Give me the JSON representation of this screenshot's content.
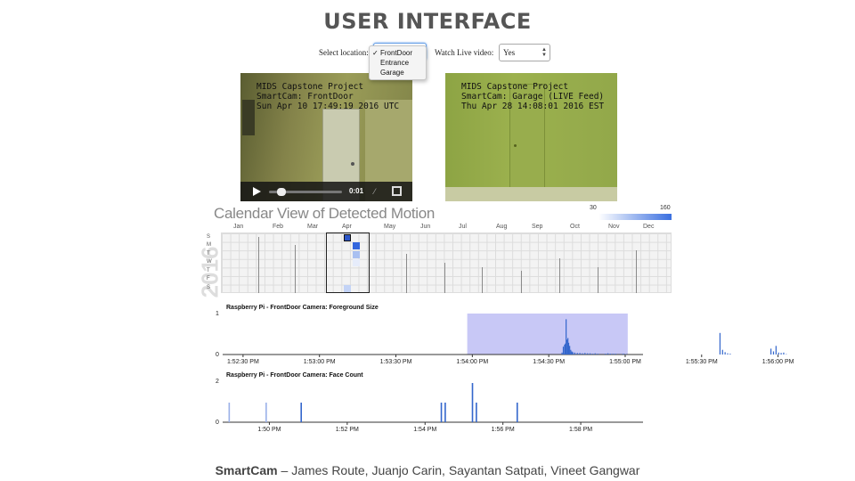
{
  "page": {
    "title": "USER INTERFACE"
  },
  "controls": {
    "location_label": "Select location:",
    "location_options": [
      "FrontDoor",
      "Entrance",
      "Garage"
    ],
    "location_selected": "FrontDoor",
    "live_label": "Watch Live video:",
    "live_value": "Yes"
  },
  "cameras": {
    "cam1": {
      "line1": "MIDS Capstone Project",
      "line2": "SmartCam: FrontDoor",
      "line3": "Sun Apr 10 17:49:19 2016 UTC",
      "time": "0:01"
    },
    "cam2": {
      "line1": "MIDS Capstone Project",
      "line2": "SmartCam: Garage (LIVE Feed)",
      "line3": "Thu Apr 28 14:08:01 2016 EST"
    }
  },
  "calendar": {
    "title": "Calendar View of Detected Motion",
    "year": "2016",
    "legend_min": "30",
    "legend_max": "160",
    "months": [
      "Jan",
      "Feb",
      "Mar",
      "Apr",
      "May",
      "Jun",
      "Jul",
      "Aug",
      "Sep",
      "Oct",
      "Nov",
      "Dec"
    ],
    "weekdays": [
      "S",
      "M",
      "T",
      "W",
      "T",
      "F",
      "S"
    ]
  },
  "chart_data": [
    {
      "type": "bar",
      "title": "Raspberry Pi - FrontDoor Camera: Foreground Size",
      "yticks": [
        "0",
        "1"
      ],
      "ylim": [
        0,
        1
      ],
      "xticks": [
        "1:52:30 PM",
        "1:53:00 PM",
        "1:53:30 PM",
        "1:54:00 PM",
        "1:54:30 PM",
        "1:55:00 PM",
        "1:55:30 PM",
        "1:56:00 PM"
      ],
      "x_seconds": [
        5,
        5.5,
        6,
        6.3,
        6.6,
        7,
        7.3,
        7.6,
        8,
        8.4,
        8.8,
        9.2,
        10,
        11,
        12,
        13,
        14,
        15,
        16,
        17,
        18,
        19,
        22,
        23,
        24,
        25,
        26,
        29,
        30,
        67,
        68,
        69,
        70,
        71,
        87,
        88,
        89,
        90,
        91,
        92,
        93
      ],
      "values": [
        0.05,
        0.2,
        0.25,
        0.28,
        0.9,
        0.38,
        0.42,
        0.3,
        0.22,
        0.12,
        0.08,
        0.06,
        0.05,
        0.04,
        0.04,
        0.03,
        0.04,
        0.03,
        0.03,
        0.02,
        0.03,
        0.02,
        0.02,
        0.03,
        0.02,
        0.02,
        0.02,
        0.02,
        0.01,
        0.55,
        0.12,
        0.06,
        0.03,
        0.02,
        0.15,
        0.08,
        0.22,
        0.05,
        0.04,
        0.05,
        0.01
      ],
      "highlight_range": [
        "1:53:58 PM",
        "1:55:01 PM"
      ]
    },
    {
      "type": "bar",
      "title": "Raspberry Pi - FrontDoor Camera: Face Count",
      "yticks": [
        "0",
        "2"
      ],
      "ylim": [
        0,
        2
      ],
      "xticks": [
        "1:50 PM",
        "1:52 PM",
        "1:54 PM",
        "1:56 PM",
        "1:58 PM"
      ],
      "x_minutes": [
        -0.25,
        0.7,
        1.6,
        5.2,
        5.3,
        6.0,
        6.1,
        7.15
      ],
      "values": [
        1,
        1,
        1,
        1,
        1,
        2,
        1,
        1
      ]
    }
  ],
  "footer": {
    "brand": "SmartCam",
    "authors": " – James Route, Juanjo Carin, Sayantan Satpati, Vineet Gangwar"
  }
}
